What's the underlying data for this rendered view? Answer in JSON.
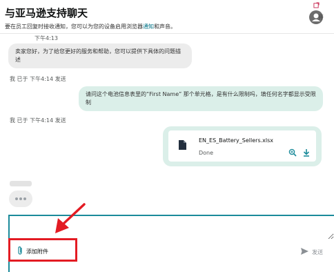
{
  "header": {
    "title": "与亚马逊支持聊天",
    "subtitle_prefix": "要在员工回复时接收通知，您可以为您的设备启用浏览器",
    "subtitle_link": "通知",
    "subtitle_suffix": "和声音。",
    "popout_label": "开"
  },
  "messages": {
    "agent_time": "下午4:13",
    "agent_text": "卖家您好，为了给您更好的服务和帮助，您可以提供下具体的问题描述",
    "me1_meta": "我  已于 下午4:14 发送",
    "me1_text": "请问这个电池信息表里的“First Name” 那个单元格，是有什么限制吗，填任何名字都显示受限制",
    "me2_meta": "我  已于 下午4:14 发送",
    "file": {
      "name": "EN_ES_Battery_Sellers.xlsx",
      "status": "Done"
    }
  },
  "composer": {
    "placeholder": "",
    "attach_label": "添加附件",
    "send_label": "发送"
  },
  "colors": {
    "accent_teal": "#1a8a9a",
    "my_bubble": "#dbefe9",
    "agent_bubble": "#ececec",
    "highlight_red": "#e31b23"
  }
}
